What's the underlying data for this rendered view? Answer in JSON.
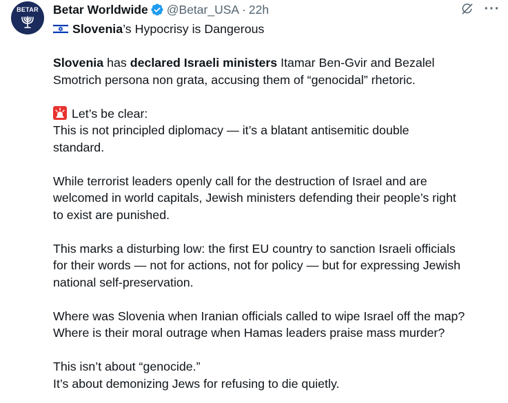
{
  "author": {
    "display_name": "Betar Worldwide",
    "handle": "@Betar_USA",
    "separator": "·",
    "time": "22h",
    "avatar_text": "BETAR"
  },
  "icons": {
    "verified": "verified-badge-icon",
    "grok": "grok-icon",
    "more": "more-options-icon",
    "flag": "israel-flag-icon",
    "siren": "siren-icon"
  },
  "colors": {
    "verified": "#1d9bf0",
    "secondary_text": "#536471",
    "text": "#0f1419",
    "avatar_bg": "#1a2b5c"
  },
  "tweet": {
    "headline_bold": "Slovenia",
    "headline_rest": "’s Hypocrisy is Dangerous",
    "p1_l1_b1": "Slovenia",
    "p1_l1_t1": " has ",
    "p1_l1_b2": "declared Israeli ministers",
    "p1_l1_t2": " Itamar Ben-Gvir and Bezalel",
    "p1_l2": "Smotrich persona non grata, accusing them of “genocidal” rhetoric.",
    "p2_l1": "Let’s be clear:",
    "p2_l2": "This is not principled diplomacy — it’s a blatant antisemitic double",
    "p2_l3": "standard.",
    "p3_l1": "While terrorist leaders openly call for the destruction of Israel and are",
    "p3_l2": "welcomed in world capitals, Jewish ministers defending their people’s right",
    "p3_l3": "to exist are punished.",
    "p4_l1": "This marks a disturbing low: the first EU country to sanction Israeli officials",
    "p4_l2": "for their words — not for actions, not for policy — but for expressing Jewish",
    "p4_l3": "national self-preservation.",
    "p5_l1": "Where was Slovenia when Iranian officials called to wipe Israel off the map?",
    "p5_l2": "Where is their moral outrage when Hamas leaders praise mass murder?",
    "p6_l1": "This isn’t about “genocide.”",
    "p6_l2": "It’s about demonizing Jews for refusing to die quietly.",
    "more_dots": "···"
  }
}
